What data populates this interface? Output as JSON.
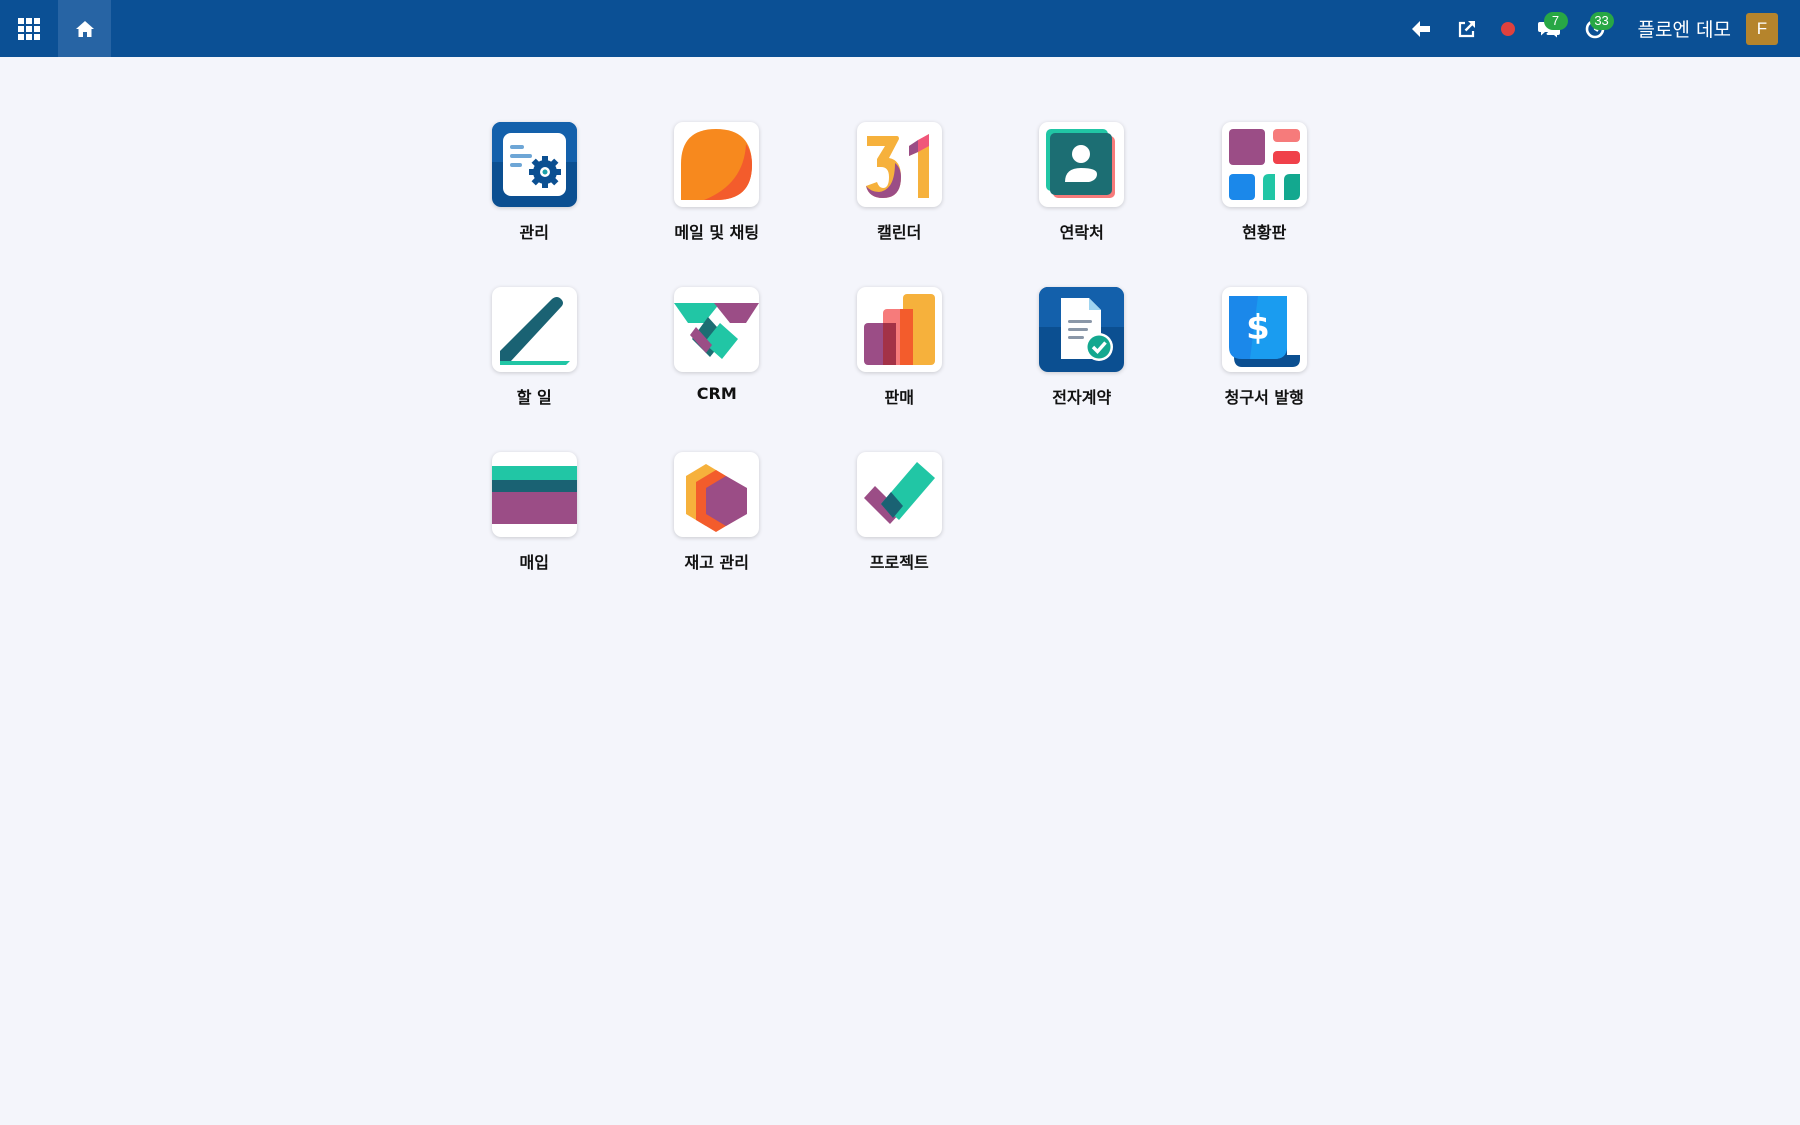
{
  "navbar": {
    "apps_icon": "grid-icon",
    "home_icon": "home-icon",
    "back_icon": "arrow-left-icon",
    "external_icon": "external-link-icon",
    "status_color": "#e0413e",
    "messages_badge": "7",
    "activities_badge": "33",
    "user_name": "플로엔 데모",
    "avatar_letter": "F",
    "bar_color": "#0b5095"
  },
  "apps": [
    {
      "label": "관리",
      "icon": "settings-app-icon"
    },
    {
      "label": "메일 및 채팅",
      "icon": "discuss-app-icon"
    },
    {
      "label": "캘린더",
      "icon": "calendar-app-icon"
    },
    {
      "label": "연락처",
      "icon": "contacts-app-icon"
    },
    {
      "label": "현황판",
      "icon": "dashboard-app-icon"
    },
    {
      "label": "할 일",
      "icon": "todo-app-icon"
    },
    {
      "label": "CRM",
      "icon": "crm-app-icon"
    },
    {
      "label": "판매",
      "icon": "sales-app-icon"
    },
    {
      "label": "전자계약",
      "icon": "sign-app-icon"
    },
    {
      "label": "청구서 발행",
      "icon": "invoicing-app-icon"
    },
    {
      "label": "매입",
      "icon": "purchase-app-icon"
    },
    {
      "label": "재고 관리",
      "icon": "inventory-app-icon"
    },
    {
      "label": "프로젝트",
      "icon": "project-app-icon"
    }
  ]
}
